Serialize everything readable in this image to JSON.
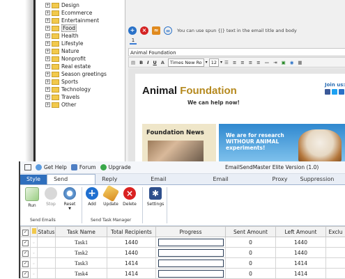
{
  "tree": {
    "items": [
      {
        "label": "Design",
        "selected": false
      },
      {
        "label": "Ecommerce",
        "selected": false
      },
      {
        "label": "Entertainment",
        "selected": false
      },
      {
        "label": "Food",
        "selected": true
      },
      {
        "label": "Health",
        "selected": false
      },
      {
        "label": "Lifestyle",
        "selected": false
      },
      {
        "label": "Nature",
        "selected": false
      },
      {
        "label": "Nonprofit",
        "selected": false
      },
      {
        "label": "Real estate",
        "selected": false
      },
      {
        "label": "Season greetings",
        "selected": false
      },
      {
        "label": "Sports",
        "selected": false
      },
      {
        "label": "Technology",
        "selected": false
      },
      {
        "label": "Travels",
        "selected": false
      },
      {
        "label": "Other",
        "selected": false
      }
    ]
  },
  "editor": {
    "hint": "You can use spun {|} text in the email title and body",
    "tab_number": "1",
    "subject": "Animal Foundation",
    "toolbar": {
      "bold": "B",
      "italic": "I",
      "underline": "U",
      "font": "Times New Ro",
      "size": "12"
    }
  },
  "newsletter": {
    "title_a": "Animal ",
    "title_b": "Foundation",
    "tagline": "We can help now!",
    "join": "Join us:",
    "news_title": "Foundation News",
    "banner_line1": "We are for research",
    "banner_line2": "WITHOUR ANIMAL",
    "banner_line3": "experiments!"
  },
  "app": {
    "title": "EmailSendMaster Elite Version (1.0)",
    "quick": {
      "help": "Get Help",
      "forum": "Forum",
      "upgrade": "Upgrade"
    },
    "tabs": [
      "Style",
      "Send Task(s)",
      "Reply Task(s)",
      "Email Template(s)",
      "Email Account(s)",
      "Proxy",
      "Suppression L"
    ],
    "active_tab": "Send Task(s)",
    "ribbon": {
      "run": "Run",
      "stop": "Stop",
      "reset": "Reset",
      "add": "Add",
      "update": "Update",
      "delete": "Delete",
      "settings": "Settings",
      "group_emails": "Send Emails",
      "group_tasks": "Send Task Manager"
    }
  },
  "grid": {
    "headers": [
      "Status",
      "Task Name",
      "Total Recipients",
      "Progress",
      "Sent Amount",
      "Left Amount",
      "Exclu"
    ],
    "rows": [
      {
        "name": "Task1",
        "total": "1440",
        "progress": 0,
        "sent": "0",
        "left": "1440"
      },
      {
        "name": "Task2",
        "total": "1440",
        "progress": 0,
        "sent": "0",
        "left": "1440"
      },
      {
        "name": "Task3",
        "total": "1414",
        "progress": 0,
        "sent": "0",
        "left": "1414"
      },
      {
        "name": "Task4",
        "total": "1414",
        "progress": 0,
        "sent": "0",
        "left": "1414"
      }
    ]
  },
  "colors": {
    "accent": "#2f6fbd",
    "folder": "#f2c94c",
    "brand_gold": "#b5891e"
  }
}
